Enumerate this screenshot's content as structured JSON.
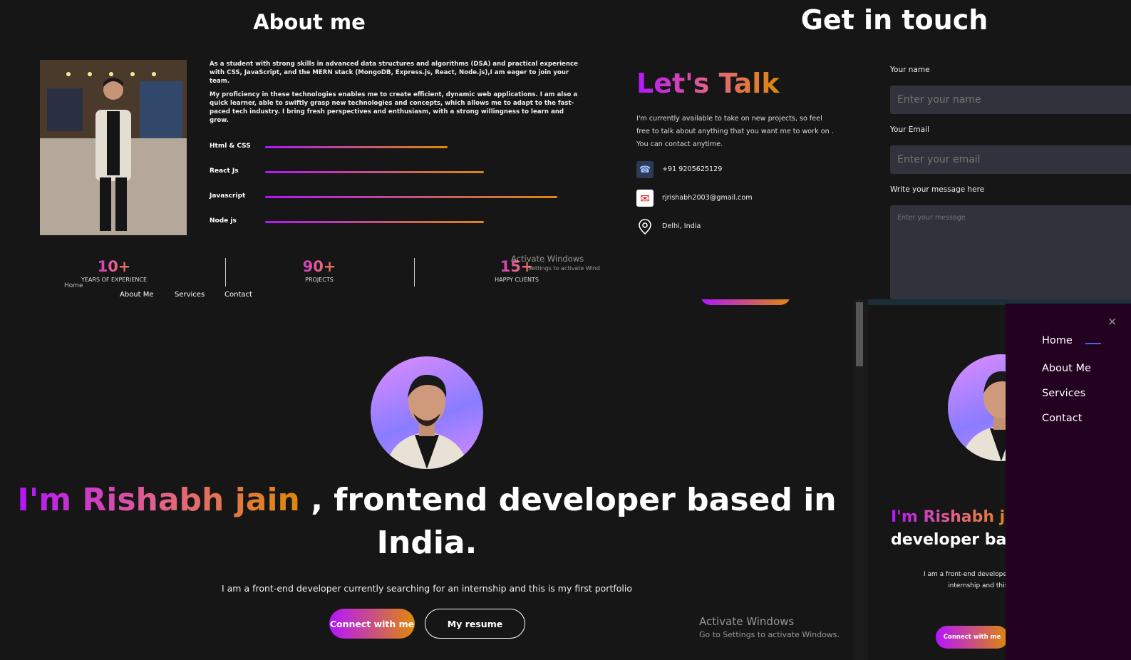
{
  "about": {
    "title": "About me",
    "paragraph1": "As a student with strong skills in advanced data structures and algorithms (DSA) and practical experience with CSS, JavaScript, and the MERN stack (MongoDB, Express.js, React, Node.js),I am eager to join your team.",
    "paragraph2": "My proficiency in these technologies enables me to create efficient, dynamic web applications. I am also a quick learner, able to swiftly grasp new technologies and concepts, which allows me to adapt to the fast-paced tech industry. I bring fresh perspectives and enthusiasm, with a strong willingness to learn and grow.",
    "skills": [
      {
        "label": "Html & CSS",
        "level": 0.5
      },
      {
        "label": "React Js",
        "level": 0.6
      },
      {
        "label": "Javascript",
        "level": 0.8
      },
      {
        "label": "Node js",
        "level": 0.6
      }
    ],
    "stats": [
      {
        "value": "10+",
        "caption": "YEARS OF EXPERIENCE"
      },
      {
        "value": "90+",
        "caption": "PROJECTS"
      },
      {
        "value": "15+",
        "caption": "HAPPY CLIENTS"
      }
    ],
    "nav": [
      "Home",
      "About Me",
      "Services",
      "Contact"
    ],
    "activate_line1": "Activate Windows",
    "activate_line2": "Settings to activate Wind"
  },
  "contact": {
    "title": "Get in touch",
    "heading": "Let's Talk",
    "description": "I'm currently available to take on new projects, so feel free to talk about anything that you want me to work on . You can contact anytime.",
    "phone": "+91 9205625129",
    "email": "rjrishabh2003@gmail.com",
    "location": "Delhi, India",
    "name_label": "Your name",
    "name_placeholder": "Enter your name",
    "email_label": "Your Email",
    "email_placeholder": "Enter your email",
    "message_label": "Write your message here",
    "message_placeholder": "Enter your message"
  },
  "hero": {
    "title_highlight": "I'm Rishabh jain",
    "title_rest": " , frontend developer based in India.",
    "subtitle": "I am a front-end developer currently searching for an internship and this is my first portfolio",
    "connect_label": "Connect with me",
    "resume_label": "My resume",
    "activate_line1": "Activate Windows",
    "activate_line2": "Go to Settings to activate Windows."
  },
  "mobile": {
    "title_highlight": "I'm Rishabh ja",
    "title_line2": "developer ba",
    "sub_line1": "I am a front-end developer c",
    "sub_line2": "internship and this is",
    "connect_label": "Connect with me",
    "menu": [
      "Home",
      "About Me",
      "Services",
      "Contact"
    ],
    "close_icon": "close-icon"
  },
  "colors": {
    "background": "#161616",
    "gradient_start": "#b415ff",
    "gradient_end": "#df8908",
    "input_bg": "#32323c",
    "drawer_bg": "#230120"
  }
}
